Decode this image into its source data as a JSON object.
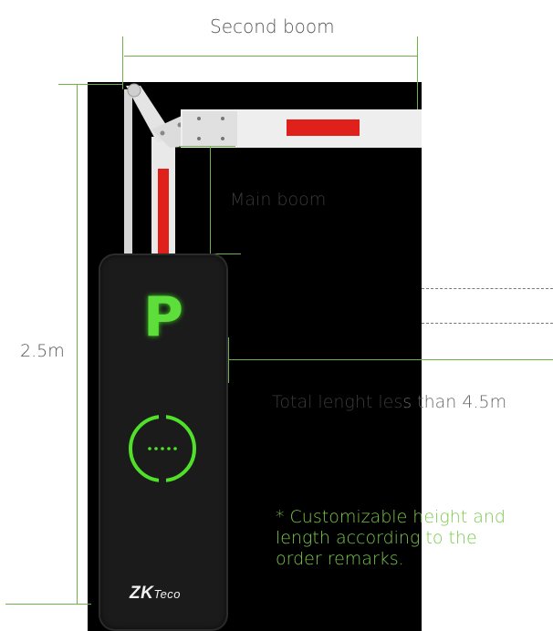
{
  "labels": {
    "second_boom": "Second boom",
    "main_boom": "Main boom",
    "height": "2.5m",
    "total_length_part1": "Total lenght les",
    "total_length_part2": "s than 4.5m",
    "note_part1_dark": "* Customizable",
    "note_part1_light": " height and",
    "note_part2_dark": "length accord",
    "note_part2_light": "ing to the",
    "note_part3": "order remarks."
  },
  "cabinet": {
    "sign_letter": "P",
    "brand_zk": "ZK",
    "brand_teco": "Teco"
  },
  "colors": {
    "dimension_line": "#6fb24a",
    "sign_green": "#5ede3a",
    "note_green": "#7ac94b",
    "boom_stripe": "#e0201b"
  },
  "icons": {
    "ring": "circle-dotted-icon"
  }
}
